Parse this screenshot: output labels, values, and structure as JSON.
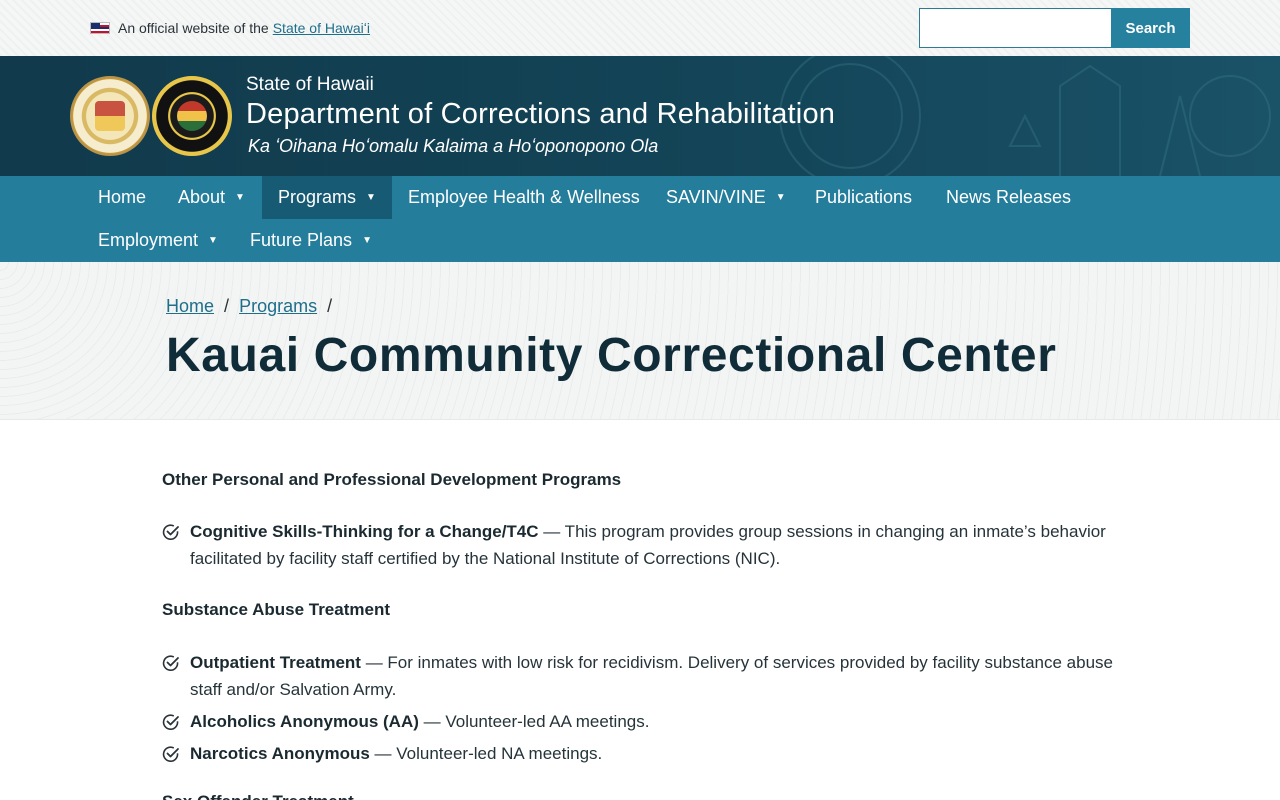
{
  "official_bar": {
    "text": "An official website of the",
    "link": "State of Hawaiʻi"
  },
  "search": {
    "placeholder": "",
    "button_label": "Search"
  },
  "banner": {
    "state": "State of Hawaii",
    "department": "Department of Corrections and Rehabilitation",
    "motto": "Ka ʻOihana Hoʻomalu Kalaima a Hoʻoponopono Ola"
  },
  "nav": {
    "items": [
      {
        "label": "Home",
        "dropdown": false,
        "active": false
      },
      {
        "label": "About",
        "dropdown": true,
        "active": false
      },
      {
        "label": "Programs",
        "dropdown": true,
        "active": true
      },
      {
        "label": "Employee Health & Wellness",
        "dropdown": false,
        "active": false
      },
      {
        "label": "SAVIN/VINE",
        "dropdown": true,
        "active": false
      },
      {
        "label": "Publications",
        "dropdown": false,
        "active": false
      },
      {
        "label": "News Releases",
        "dropdown": false,
        "active": false
      },
      {
        "label": "Employment",
        "dropdown": true,
        "active": false
      },
      {
        "label": "Future Plans",
        "dropdown": true,
        "active": false
      }
    ],
    "caret": "▼"
  },
  "breadcrumb": {
    "home": "Home",
    "programs": "Programs",
    "separator": "/"
  },
  "page_title": "Kauai Community Correctional Center",
  "content": {
    "sections": [
      {
        "heading": "Other Personal and Professional Development Programs",
        "items": [
          {
            "title": "Cognitive Skills-Thinking for a Change/T4C",
            "description": " — This program provides group sessions in changing an inmate’s behavior facilitated by facility staff certified by the National Institute of Corrections (NIC)."
          }
        ]
      },
      {
        "heading": "Substance Abuse Treatment",
        "items": [
          {
            "title": "Outpatient Treatment",
            "description": " — For inmates with low risk for recidivism. Delivery of services provided by facility substance abuse staff and/or Salvation Army."
          },
          {
            "title": "Alcoholics Anonymous (AA)",
            "description": " — Volunteer-led AA meetings."
          },
          {
            "title": "Narcotics Anonymous",
            "description": " — Volunteer-led NA meetings."
          }
        ]
      }
    ],
    "partial_heading": "Sex Offender Treatment"
  },
  "colors": {
    "nav_bg": "#237d9b",
    "nav_active": "#165b73",
    "banner_bg": "#134457",
    "link": "#1f6f8b",
    "title": "#0f2c38"
  }
}
